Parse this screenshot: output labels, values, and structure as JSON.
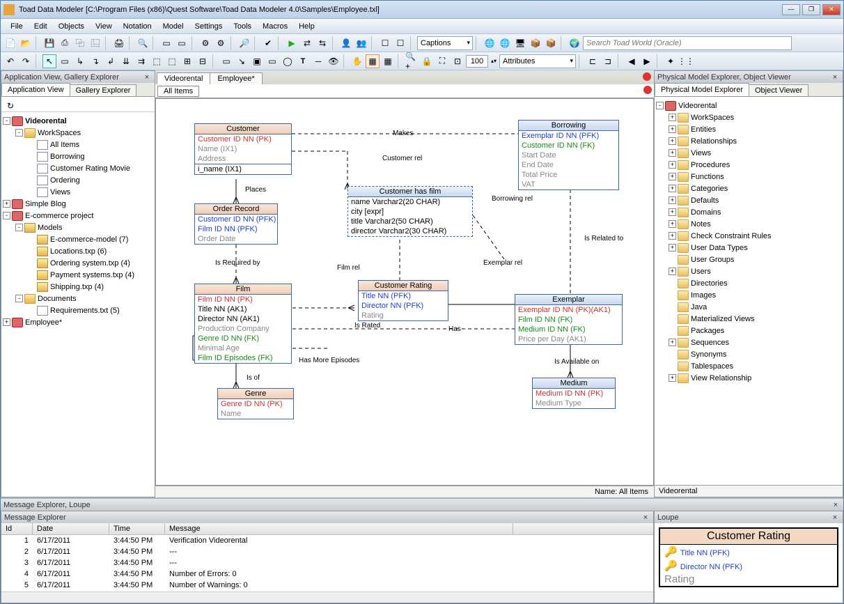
{
  "window": {
    "title": "Toad Data Modeler  [C:\\Program Files (x86)\\Quest Software\\Toad Data Modeler 4.0\\Samples\\Employee.txl]"
  },
  "menu": [
    "File",
    "Edit",
    "Objects",
    "View",
    "Notation",
    "Model",
    "Settings",
    "Tools",
    "Macros",
    "Help"
  ],
  "toolbar": {
    "captions": "Captions",
    "zoom": "100",
    "attributes": "Attributes",
    "search_placeholder": "Search Toad World (Oracle)"
  },
  "left": {
    "panel_title": "Application View, Gallery Explorer",
    "tabs": [
      "Application View",
      "Gallery Explorer"
    ],
    "tree": [
      {
        "ind": 0,
        "exp": "-",
        "ico": "db",
        "text": "Videorental",
        "bold": true
      },
      {
        "ind": 1,
        "exp": "-",
        "ico": "folder",
        "text": "WorkSpaces"
      },
      {
        "ind": 2,
        "exp": "",
        "ico": "page",
        "text": "All Items"
      },
      {
        "ind": 2,
        "exp": "",
        "ico": "page",
        "text": "Borrowing"
      },
      {
        "ind": 2,
        "exp": "",
        "ico": "page",
        "text": "Customer Rating Movie"
      },
      {
        "ind": 2,
        "exp": "",
        "ico": "page",
        "text": "Ordering"
      },
      {
        "ind": 2,
        "exp": "",
        "ico": "page",
        "text": "Views"
      },
      {
        "ind": 0,
        "exp": "+",
        "ico": "db",
        "text": "Simple Blog"
      },
      {
        "ind": 0,
        "exp": "-",
        "ico": "db",
        "text": "E-commerce project"
      },
      {
        "ind": 1,
        "exp": "-",
        "ico": "model",
        "text": "Models"
      },
      {
        "ind": 2,
        "exp": "",
        "ico": "model",
        "text": "E-commerce-model  (7)"
      },
      {
        "ind": 2,
        "exp": "",
        "ico": "model",
        "text": "Locations.txp  (6)"
      },
      {
        "ind": 2,
        "exp": "",
        "ico": "model",
        "text": "Ordering system.txp  (4)"
      },
      {
        "ind": 2,
        "exp": "",
        "ico": "model",
        "text": "Payment systems.txp  (4)"
      },
      {
        "ind": 2,
        "exp": "",
        "ico": "model",
        "text": "Shipping.txp  (4)"
      },
      {
        "ind": 1,
        "exp": "-",
        "ico": "folder",
        "text": "Documents"
      },
      {
        "ind": 2,
        "exp": "",
        "ico": "page",
        "text": "Requirements.txt  (5)"
      },
      {
        "ind": 0,
        "exp": "+",
        "ico": "db",
        "text": "Employee*"
      }
    ]
  },
  "center": {
    "doc_tabs": [
      "Videorental",
      "Employee*"
    ],
    "sub_tabs": [
      "All Items"
    ],
    "status": "Name: All Items",
    "entities": {
      "customer": {
        "title": "Customer",
        "rows": [
          [
            "pk",
            "Customer ID NN  (PK)"
          ],
          [
            "grey",
            "Name   (IX1)"
          ],
          [
            "grey",
            "Address"
          ],
          [
            "sep",
            ""
          ],
          [
            "",
            "i_name (IX1)"
          ]
        ]
      },
      "order": {
        "title": "Order Record",
        "rows": [
          [
            "lnk",
            "Customer ID NN   (PFK)"
          ],
          [
            "lnk",
            "Film ID NN   (PFK)"
          ],
          [
            "grey",
            "Order Date"
          ]
        ]
      },
      "film": {
        "title": "Film",
        "rows": [
          [
            "pk",
            "Film ID NN  (PK)"
          ],
          [
            "",
            "Title NN  (AK1)"
          ],
          [
            "",
            "Director NN (AK1)"
          ],
          [
            "grey",
            "Production Company"
          ],
          [
            "fk",
            "Genre ID NN   (FK)"
          ],
          [
            "grey",
            "Minimal Age"
          ],
          [
            "fk",
            "Film ID Episodes   (FK)"
          ]
        ]
      },
      "genre": {
        "title": "Genre",
        "rows": [
          [
            "pk",
            "Genre ID NN  (PK)"
          ],
          [
            "grey",
            "Name"
          ]
        ]
      },
      "chf": {
        "title": "Customer has film",
        "rows": [
          [
            "",
            "name      Varchar2(20 CHAR)"
          ],
          [
            "",
            "city         [expr]"
          ],
          [
            "",
            "title         Varchar2(50 CHAR)"
          ],
          [
            "",
            "director   Varchar2(30 CHAR)"
          ]
        ]
      },
      "crating": {
        "title": "Customer Rating",
        "rows": [
          [
            "lnk",
            "Title NN   (PFK)"
          ],
          [
            "lnk",
            "Director NN   (PFK)"
          ],
          [
            "grey",
            "Rating"
          ]
        ]
      },
      "borrowing": {
        "title": "Borrowing",
        "rows": [
          [
            "lnk",
            "Exemplar ID NN   (PFK)"
          ],
          [
            "fk",
            "Customer ID NN   (FK)"
          ],
          [
            "grey",
            "Start Date"
          ],
          [
            "grey",
            "End Date"
          ],
          [
            "grey",
            "Total Price"
          ],
          [
            "grey",
            "VAT"
          ]
        ]
      },
      "exemplar": {
        "title": "Exemplar",
        "rows": [
          [
            "pk",
            "Exemplar ID NN  (PK)(AK1)"
          ],
          [
            "fk",
            "Film ID NN   (FK)"
          ],
          [
            "fk",
            "Medium ID NN   (FK)"
          ],
          [
            "grey",
            "Price per Day  (AK1)"
          ]
        ]
      },
      "medium": {
        "title": "Medium",
        "rows": [
          [
            "pk",
            "Medium ID NN  (PK)"
          ],
          [
            "grey",
            "Medium Type"
          ]
        ]
      }
    },
    "labels": {
      "makes": "Makes",
      "customerrel": "Customer rel",
      "places": "Places",
      "filmrel": "Film rel",
      "isrequired": "Is Required by",
      "isof": "Is of",
      "hasmore": "Has More Episodes",
      "israted": "Is Rated",
      "has": "Has",
      "borrowingrel": "Borrowing rel",
      "isrelated": "Is Related to",
      "exemplarrel": "Exemplar rel",
      "isavail": "Is Available on"
    }
  },
  "right": {
    "panel_title": "Physical Model Explorer, Object Viewer",
    "tabs": [
      "Physical Model Explorer",
      "Object Viewer"
    ],
    "root": "Videorental",
    "items": [
      "WorkSpaces",
      "Entities",
      "Relationships",
      "Views",
      "Procedures",
      "Functions",
      "Categories",
      "Defaults",
      "Domains",
      "Notes",
      "Check Constraint Rules",
      "User Data Types",
      "User Groups",
      "Users",
      "Directories",
      "Images",
      "Java",
      "Materialized Views",
      "Packages",
      "Sequences",
      "Synonyms",
      "Tablespaces",
      "View Relationship"
    ],
    "expandable": [
      0,
      1,
      2,
      3,
      4,
      5,
      6,
      7,
      8,
      9,
      10,
      11,
      13,
      19,
      22
    ],
    "status": "Videorental"
  },
  "bottom": {
    "panel_title": "Message Explorer, Loupe",
    "msg_tab": "Message Explorer",
    "loupe_tab": "Loupe",
    "cols": [
      "Id",
      "Date",
      "Time",
      "Message"
    ],
    "rows": [
      [
        "1",
        "6/17/2011",
        "3:44:50 PM",
        "Verification Videorental"
      ],
      [
        "2",
        "6/17/2011",
        "3:44:50 PM",
        "---"
      ],
      [
        "3",
        "6/17/2011",
        "3:44:50 PM",
        "---"
      ],
      [
        "4",
        "6/17/2011",
        "3:44:50 PM",
        "Number of Errors: 0"
      ],
      [
        "5",
        "6/17/2011",
        "3:44:50 PM",
        "Number of Warnings: 0"
      ]
    ],
    "loupe": {
      "title": "Customer Rating",
      "rows": [
        "Title NN  (PFK)",
        "Director NN  (PFK)"
      ],
      "grey": "Rating"
    }
  }
}
